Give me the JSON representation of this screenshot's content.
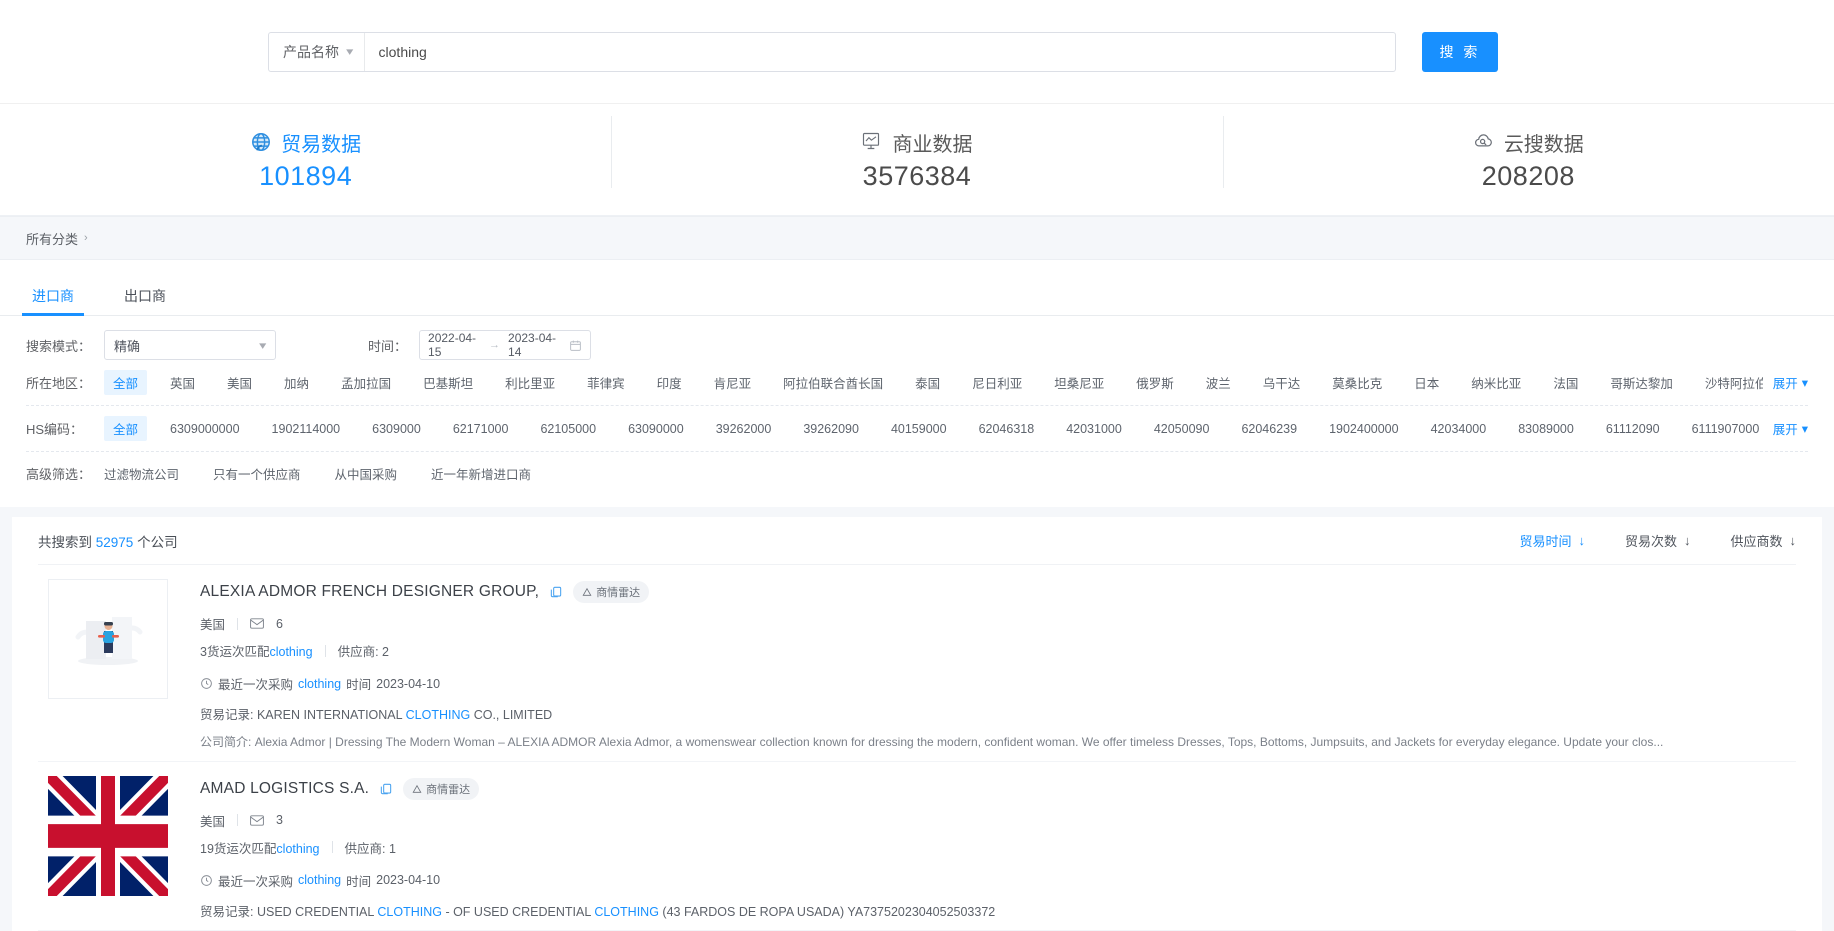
{
  "search": {
    "category_label": "产品名称",
    "input_value": "clothing",
    "input_placeholder": "",
    "button_label": "搜 索"
  },
  "stats": [
    {
      "label": "贸易数据",
      "value": "101894",
      "icon": "globe-icon",
      "active": true
    },
    {
      "label": "商业数据",
      "value": "3576384",
      "icon": "chart-box-icon",
      "active": false
    },
    {
      "label": "云搜数据",
      "value": "208208",
      "icon": "cloud-search-icon",
      "active": false
    }
  ],
  "breadcrumb": {
    "label": "所有分类",
    "arrow": "›"
  },
  "tabs": [
    {
      "label": "进口商",
      "active": true
    },
    {
      "label": "出口商",
      "active": false
    }
  ],
  "filters": {
    "mode_label": "搜索模式：",
    "mode_value": "精确",
    "time_label": "时间：",
    "date_start": "2022-04-15",
    "date_end": "2023-04-14",
    "date_sep": "→",
    "region_label": "所在地区：",
    "regions": [
      "全部",
      "英国",
      "美国",
      "加纳",
      "孟加拉国",
      "巴基斯坦",
      "利比里亚",
      "菲律宾",
      "印度",
      "肯尼亚",
      "阿拉伯联合酋长国",
      "泰国",
      "尼日利亚",
      "坦桑尼亚",
      "俄罗斯",
      "波兰",
      "乌干达",
      "莫桑比克",
      "日本",
      "纳米比亚",
      "法国",
      "哥斯达黎加",
      "沙特阿拉伯"
    ],
    "region_selected": "全部",
    "hs_label": "HS编码：",
    "hs_codes": [
      "全部",
      "6309000000",
      "1902114000",
      "6309000",
      "62171000",
      "62105000",
      "63090000",
      "39262000",
      "39262090",
      "40159000",
      "62046318",
      "42031000",
      "42050090",
      "62046239",
      "1902400000",
      "42034000",
      "83089000",
      "61112090",
      "6111907000"
    ],
    "hs_selected": "全部",
    "expand_label": "展开",
    "advanced_label": "高级筛选：",
    "advanced": [
      "过滤物流公司",
      "只有一个供应商",
      "从中国采购",
      "近一年新增进口商"
    ]
  },
  "results": {
    "count_prefix": "共搜索到",
    "count": "52975",
    "count_suffix": "个公司",
    "sorts": [
      {
        "label": "贸易时间",
        "arrow": "↓",
        "active": true
      },
      {
        "label": "贸易次数",
        "arrow": "↓",
        "active": false
      },
      {
        "label": "供应商数",
        "arrow": "↓",
        "active": false
      }
    ],
    "items": [
      {
        "title": "ALEXIA ADMOR FRENCH DESIGNER GROUP,",
        "badge": "商情雷达",
        "country": "美国",
        "mail_count": "6",
        "shipments_prefix": "3",
        "shipments_text": "货运次匹配",
        "shipments_keyword": "clothing",
        "suppliers_label": "供应商:",
        "suppliers_count": "2",
        "recent_prefix": "最近一次采购",
        "recent_keyword": "clothing",
        "recent_mid": "时间",
        "recent_date": "2023-04-10",
        "record_label": "贸易记录:",
        "record_pre": "KAREN INTERNATIONAL",
        "record_hl": "CLOTHING",
        "record_post": "CO., LIMITED",
        "desc_label": "公司简介:",
        "desc": "Alexia Admor | Dressing The Modern Woman – ALEXIA ADMOR Alexia Admor, a womenswear collection known for dressing the modern, confident woman. We offer timeless Dresses, Tops, Bottoms, Jumpsuits, and Jackets for everyday elegance. Update your clos...",
        "thumb": "placeholder-illustration"
      },
      {
        "title": "AMAD LOGISTICS S.A.",
        "badge": "商情雷达",
        "country": "美国",
        "mail_count": "3",
        "shipments_prefix": "19",
        "shipments_text": "货运次匹配",
        "shipments_keyword": "clothing",
        "suppliers_label": "供应商:",
        "suppliers_count": "1",
        "recent_prefix": "最近一次采购",
        "recent_keyword": "clothing",
        "recent_mid": "时间",
        "recent_date": "2023-04-10",
        "record_label": "贸易记录:",
        "record_pre": "USED CREDENTIAL",
        "record_hl": "CLOTHING",
        "record_mid": "- OF USED CREDENTIAL",
        "record_hl2": "CLOTHING",
        "record_post": "(43 FARDOS DE ROPA USADA) YA7375202304052503372",
        "desc_label": "",
        "desc": "",
        "thumb": "uk-flag"
      }
    ]
  },
  "colors": {
    "accent": "#1890ff",
    "chip_selected_bg": "#e8f4ff",
    "page_bg": "#f5f7fa"
  }
}
